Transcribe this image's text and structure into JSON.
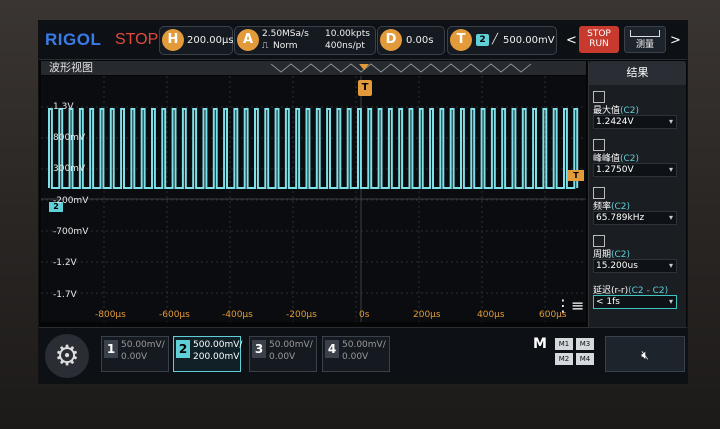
{
  "topbar": {
    "logo": "RIGOL",
    "run_state": "STOP",
    "horizontal": {
      "icon": "H",
      "value": "200.00μs/"
    },
    "acquire": {
      "icon": "A",
      "sample_rate": "2.50MSa/s",
      "mode": "Norm",
      "depth": "10.00kpts",
      "period": "400ns/pt"
    },
    "delay": {
      "icon": "D",
      "value": "0.00s"
    },
    "trigger": {
      "icon": "T",
      "channel": "2",
      "slope": "╱",
      "level": "500.00mV"
    },
    "stop_run_label": "STOP\nRUN",
    "measure_label": "测量",
    "arrow_left": "<",
    "arrow_right": ">"
  },
  "waveform": {
    "title": "波形视图",
    "y_labels": [
      "1.3V",
      "800mV",
      "300mV",
      "-200mV",
      "-700mV",
      "-1.2V",
      "-1.7V"
    ],
    "x_labels": [
      "-800μs",
      "-600μs",
      "-400μs",
      "-200μs",
      "0s",
      "200μs",
      "400μs",
      "600μs"
    ],
    "trigger_marker": "T",
    "channel_marker": "2",
    "color": "#7fe0e8"
  },
  "results": {
    "title": "结果",
    "items": [
      {
        "name": "最大值",
        "channel": "(C2)",
        "value": "1.2424V"
      },
      {
        "name": "峰峰值",
        "channel": "(C2)",
        "value": "1.2750V"
      },
      {
        "name": "频率",
        "channel": "(C2)",
        "value": "65.789kHz"
      },
      {
        "name": "周期",
        "channel": "(C2)",
        "value": "15.200us"
      },
      {
        "name": "延迟(r-r)",
        "channel": "(C2 - C2)",
        "value": "< 1fs"
      }
    ]
  },
  "channels": [
    {
      "num": "1",
      "scale": "50.00mV/",
      "offset": "0.00V"
    },
    {
      "num": "2",
      "scale": "500.00mV/",
      "offset": "200.00mV"
    },
    {
      "num": "3",
      "scale": "50.00mV/",
      "offset": "0.00V"
    },
    {
      "num": "4",
      "scale": "50.00mV/",
      "offset": "0.00V"
    }
  ],
  "math": {
    "label": "M",
    "cells": [
      "M1",
      "M3",
      "M2",
      "M4"
    ]
  },
  "colors": {
    "accent_orange": "#e39a3a",
    "channel2": "#5fd0d8",
    "stop_red": "#c83a2e",
    "logo_blue": "#3b7be8"
  }
}
